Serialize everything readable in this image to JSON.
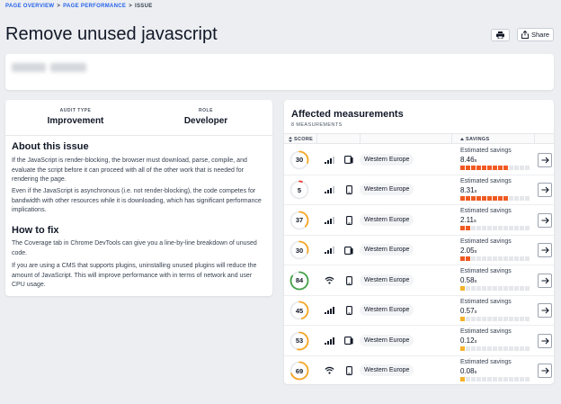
{
  "breadcrumb": {
    "item1": "PAGE OVERVIEW",
    "item2": "PAGE PERFORMANCE",
    "item3": "ISSUE",
    "separator": ">"
  },
  "title": "Remove unused javascript",
  "actions": {
    "print_icon": "print-icon",
    "share_label": "Share",
    "share_icon": "share-icon"
  },
  "details": {
    "audit_type_label": "AUDIT TYPE",
    "audit_type_value": "Improvement",
    "role_label": "ROLE",
    "role_value": "Developer",
    "about_heading": "About this issue",
    "about_p1": "If the JavaScript is render-blocking, the browser must download, parse, compile, and evaluate the script before it can proceed with all of the other work that is needed for rendering the page.",
    "about_p2": "Even if the JavaScript is asynchronous (i.e. not render-blocking), the code competes for bandwidth with other resources while it is downloading, which has significant performance implications.",
    "fix_heading": "How to fix",
    "fix_p1": "The Coverage tab in Chrome DevTools can give you a line-by-line breakdown of unused code.",
    "fix_p2": "If you are using a CMS that supports plugins, uninstalling unused plugins will reduce the amount of JavaScript. This will improve performance with in terms of network and user CPU usage."
  },
  "measurements": {
    "title": "Affected measurements",
    "count_label": "8 MEASUREMENTS",
    "col_score": "SCORE",
    "col_savings": "SAVINGS",
    "savings_label": "Estimated savings",
    "unit": "s",
    "colors": {
      "red": "#e53935",
      "orange": "#f5a623",
      "green": "#43a047",
      "bar_high": "#f05a22",
      "bar_low": "#f5b22a",
      "bar_empty": "#e5e7eb"
    },
    "rows": [
      {
        "score": "30",
        "score_fraction": 0.3,
        "color": "#f5a623",
        "network": "cell-signal-3-icon",
        "device": "tablet-icon",
        "region": "Western Europe",
        "savings": "8.46",
        "bar_level": 0.52
      },
      {
        "score": "5",
        "score_fraction": 0.05,
        "color": "#e53935",
        "network": "cell-signal-3-icon",
        "device": "phone-icon",
        "region": "Western Europe",
        "savings": "8.31",
        "bar_level": 0.52
      },
      {
        "score": "37",
        "score_fraction": 0.37,
        "color": "#f5a623",
        "network": "cell-signal-3-icon",
        "device": "phone-icon",
        "region": "Western Europe",
        "savings": "2.11",
        "bar_level": 0.13
      },
      {
        "score": "30",
        "score_fraction": 0.3,
        "color": "#f5a623",
        "network": "cell-signal-3-icon",
        "device": "tablet-icon",
        "region": "Western Europe",
        "savings": "2.05",
        "bar_level": 0.13
      },
      {
        "score": "84",
        "score_fraction": 0.84,
        "color": "#43a047",
        "network": "wifi-icon",
        "device": "phone-icon",
        "region": "Western Europe",
        "savings": "0.58",
        "bar_level": 0.04
      },
      {
        "score": "45",
        "score_fraction": 0.45,
        "color": "#f5a623",
        "network": "cell-signal-4-icon",
        "device": "phone-icon",
        "region": "Western Europe",
        "savings": "0.57",
        "bar_level": 0.04
      },
      {
        "score": "53",
        "score_fraction": 0.53,
        "color": "#f5a623",
        "network": "cell-signal-4-icon",
        "device": "tablet-icon",
        "region": "Western Europe",
        "savings": "0.12",
        "bar_level": 0.01
      },
      {
        "score": "69",
        "score_fraction": 0.69,
        "color": "#f5a623",
        "network": "wifi-icon",
        "device": "phone-icon",
        "region": "Western Europe",
        "savings": "0.08",
        "bar_level": 0.01
      }
    ]
  }
}
